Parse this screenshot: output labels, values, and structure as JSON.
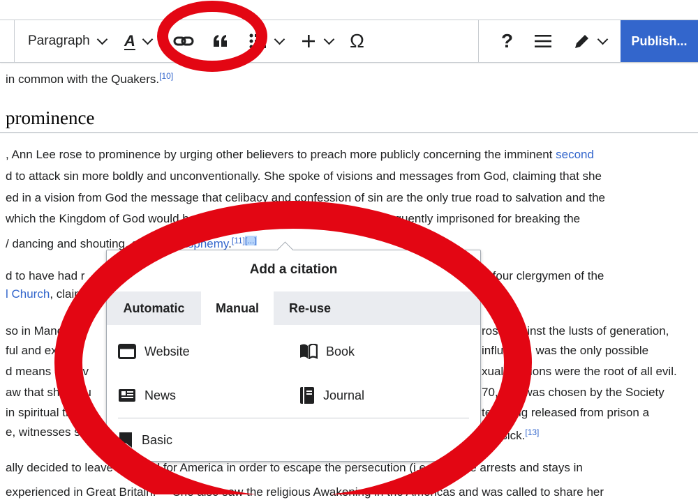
{
  "toolbar": {
    "paragraph_label": "Paragraph",
    "text_style_label": "A",
    "omega_label": "Ω",
    "help_label": "?",
    "publish_label": "Publish..."
  },
  "article": {
    "line_top": "in common with the Quakers.",
    "line_top_ref": "[10]",
    "heading": "prominence",
    "lines": [
      {
        "text": ", Ann Lee rose to prominence by urging other believers to preach more publicly concerning the imminent ",
        "link": "second"
      },
      {
        "text": "d to attack sin more boldly and unconventionally. She spoke of visions and messages from God, claiming that she"
      },
      {
        "text": "ed in a vision from God the message that celibacy and confession of sin are the only true road to salvation and the"
      },
      {
        "text": " which the Kingdom of God would be established on the earth. She was frequently imprisoned for breaking the"
      },
      {
        "text": "/ dancing and shouting, and for ",
        "link": "blasphemy",
        "after": ".",
        "ref": "[11]",
        "cite": "[...]"
      }
    ],
    "partial_lines": [
      {
        "left": "d to have had r",
        "right": "by four clergymen of the"
      },
      {
        "left_link": "l Church",
        "left": ", claim"
      },
      {
        "left": "so in Manche",
        "right": "ross against the lusts of generation,"
      },
      {
        "left": " ful and explicit",
        "right": "influence, was the only possible"
      },
      {
        "left": "d means of salv",
        "right": "xual relations were the root of all evil."
      },
      {
        "left": "aw that she wou",
        "right": "70, she was chosen by the Society"
      },
      {
        "left": " in spiritual thin",
        "right": "ter being released from prison a"
      },
      {
        "left": "e, witnesses sa",
        "right": "the sick.",
        "right_ref": "[13]"
      }
    ],
    "bottom_line_1": "ally decided to leave England for America in order to escape the persecution (i.e., multiple arrests and stays in",
    "bottom_line_2": " experienced in Great Britain.",
    "bottom_line_2_ref": "[11]",
    "bottom_line_2_rest": " She also saw the religious Awakening in the Americas and was called to share her"
  },
  "dialog": {
    "title": "Add a citation",
    "tabs": [
      "Automatic",
      "Manual",
      "Re-use"
    ],
    "active_tab": "Manual",
    "options": {
      "website": "Website",
      "book": "Book",
      "news": "News",
      "journal": "Journal",
      "basic": "Basic"
    }
  },
  "colors": {
    "annotation_red": "#e30613",
    "link_blue": "#3366cc",
    "publish_blue": "#3366cc"
  }
}
